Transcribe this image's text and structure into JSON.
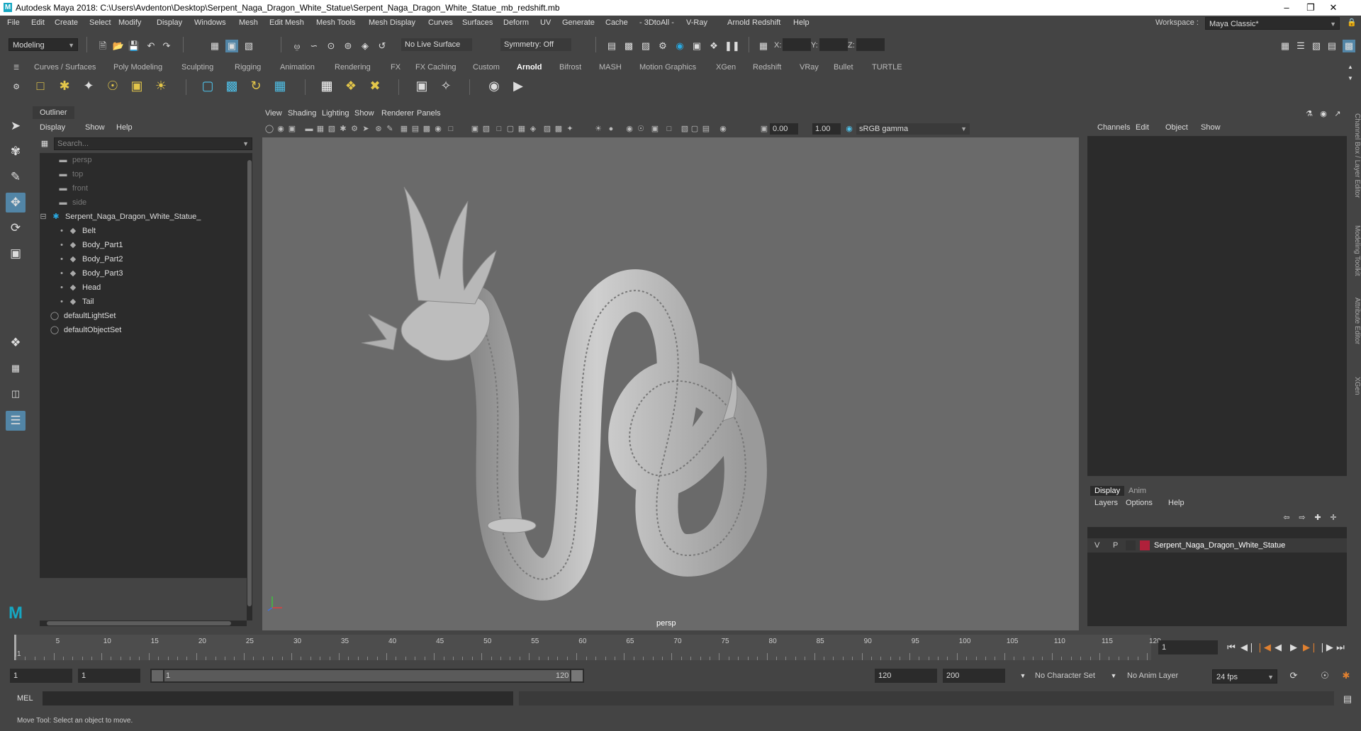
{
  "window": {
    "title": "Autodesk Maya 2018: C:\\Users\\Avdenton\\Desktop\\Serpent_Naga_Dragon_White_Statue\\Serpent_Naga_Dragon_White_Statue_mb_redshift.mb"
  },
  "menubar": [
    "File",
    "Edit",
    "Create",
    "Select",
    "Modify",
    "Display",
    "Windows",
    "Mesh",
    "Edit Mesh",
    "Mesh Tools",
    "Mesh Display",
    "Curves",
    "Surfaces",
    "Deform",
    "UV",
    "Generate",
    "Cache",
    "- 3DtoAll -",
    "V-Ray",
    "Arnold",
    "Redshift",
    "Help"
  ],
  "workspace": {
    "label": "Workspace :",
    "value": "Maya Classic*"
  },
  "statusline": {
    "mode": "Modeling",
    "live_surface": "No Live Surface",
    "symmetry": "Symmetry: Off",
    "x_label": "X:",
    "y_label": "Y:",
    "z_label": "Z:"
  },
  "shelf_tabs": [
    "Curves / Surfaces",
    "Poly Modeling",
    "Sculpting",
    "Rigging",
    "Animation",
    "Rendering",
    "FX",
    "FX Caching",
    "Custom",
    "Arnold",
    "Bifrost",
    "MASH",
    "Motion Graphics",
    "XGen",
    "Redshift",
    "VRay",
    "Bullet",
    "TURTLE"
  ],
  "shelf_active": "Arnold",
  "outliner": {
    "title": "Outliner",
    "menu": [
      "Display",
      "Show",
      "Help"
    ],
    "search_placeholder": "Search...",
    "items": [
      {
        "label": "persp",
        "dim": true
      },
      {
        "label": "top",
        "dim": true
      },
      {
        "label": "front",
        "dim": true
      },
      {
        "label": "side",
        "dim": true
      },
      {
        "label": "Serpent_Naga_Dragon_White_Statue_",
        "dim": false
      },
      {
        "label": "Belt",
        "dim": false
      },
      {
        "label": "Body_Part1",
        "dim": false
      },
      {
        "label": "Body_Part2",
        "dim": false
      },
      {
        "label": "Body_Part3",
        "dim": false
      },
      {
        "label": "Head",
        "dim": false
      },
      {
        "label": "Tail",
        "dim": false
      },
      {
        "label": "defaultLightSet",
        "dim": false
      },
      {
        "label": "defaultObjectSet",
        "dim": false
      }
    ]
  },
  "viewport": {
    "menu": [
      "View",
      "Shading",
      "Lighting",
      "Show",
      "Renderer",
      "Panels"
    ],
    "exposure": "0.00",
    "gamma": "1.00",
    "colorspace": "sRGB gamma",
    "camera": "persp"
  },
  "channelbox": {
    "menu": [
      "Channels",
      "Edit",
      "Object",
      "Show"
    ],
    "side_tabs": [
      "Channel Box / Layer Editor",
      "Modeling Toolkit",
      "Attribute Editor",
      "XGen"
    ]
  },
  "layer_editor": {
    "tabs": [
      "Display",
      "Anim"
    ],
    "menu": [
      "Layers",
      "Options",
      "Help"
    ],
    "layer": {
      "v": "V",
      "p": "P",
      "name": "Serpent_Naga_Dragon_White_Statue",
      "color": "#b0203a"
    }
  },
  "timeslider": {
    "ticks": [
      "5",
      "10",
      "15",
      "20",
      "25",
      "30",
      "35",
      "40",
      "45",
      "50",
      "55",
      "60",
      "65",
      "70",
      "75",
      "80",
      "85",
      "90",
      "95",
      "100",
      "105",
      "110",
      "115",
      "120"
    ],
    "current": "1",
    "current_frame_field": "1"
  },
  "range": {
    "start": "1",
    "playback_start": "1",
    "slider_start": "1",
    "slider_end": "120",
    "playback_end": "120",
    "end": "200",
    "character_set": "No Character Set",
    "anim_layer": "No Anim Layer",
    "fps": "24 fps"
  },
  "cmdline": {
    "label": "MEL"
  },
  "helpline": {
    "text": "Move Tool: Select an object to move."
  }
}
